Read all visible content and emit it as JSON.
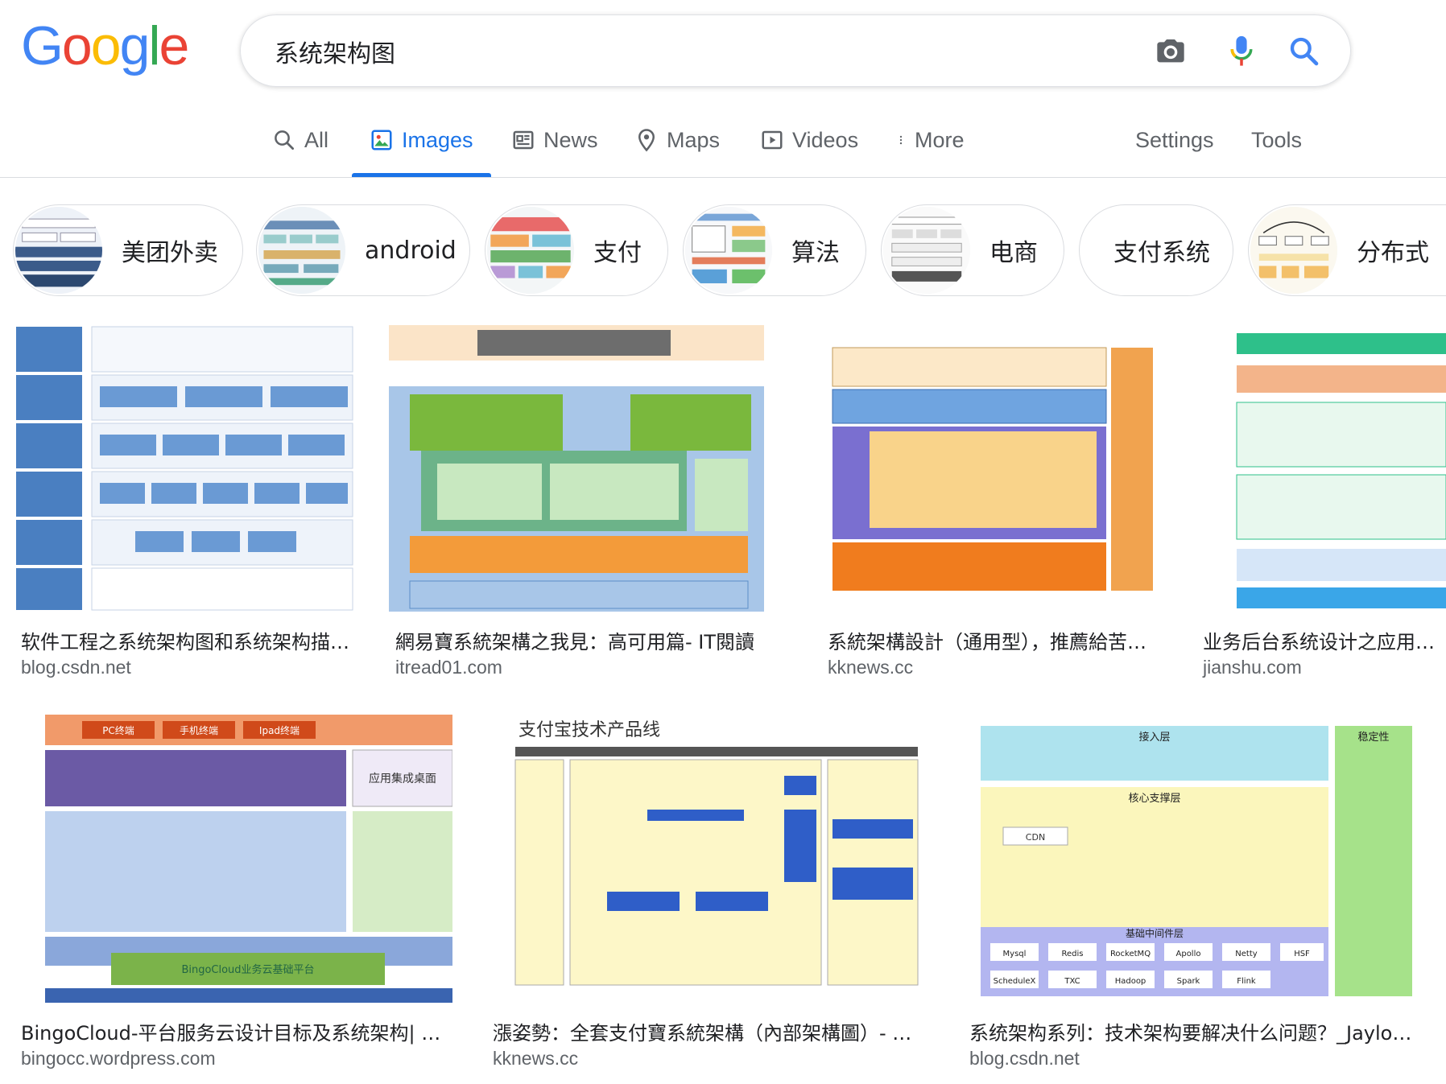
{
  "logo": {
    "letters": [
      "G",
      "o",
      "o",
      "g",
      "l",
      "e"
    ],
    "colors": [
      "#4285F4",
      "#EA4335",
      "#FBBC05",
      "#4285F4",
      "#34A853",
      "#EA4335"
    ]
  },
  "search": {
    "query": "系统架构图",
    "icons": [
      "camera-icon",
      "mic-icon",
      "search-icon"
    ]
  },
  "tabs": [
    {
      "label": "All",
      "icon": "search-icon"
    },
    {
      "label": "Images",
      "icon": "image-icon",
      "active": true
    },
    {
      "label": "News",
      "icon": "news-icon"
    },
    {
      "label": "Maps",
      "icon": "map-pin-icon"
    },
    {
      "label": "Videos",
      "icon": "video-icon"
    },
    {
      "label": "More",
      "icon": "more-vert-icon"
    },
    {
      "label": "Settings"
    },
    {
      "label": "Tools"
    }
  ],
  "chips": [
    {
      "label": "美团外卖"
    },
    {
      "label": "android"
    },
    {
      "label": "支付"
    },
    {
      "label": "算法"
    },
    {
      "label": "电商"
    },
    {
      "label": "支付系统"
    },
    {
      "label": "分布式"
    }
  ],
  "results": [
    {
      "title": "软件工程之系统架构图和系统架构描述方法",
      "site": "blog.csdn.net"
    },
    {
      "title": "網易寶系統架構之我見：高可用篇- IT閱讀",
      "site": "itread01.com"
    },
    {
      "title": "系統架構設計（通用型），推薦給苦惱的你",
      "site": "kknews.cc"
    },
    {
      "title": "业务后台系统设计之应用架构",
      "site": "jianshu.com"
    },
    {
      "title": "BingoCloud-平台服务云设计目标及系统架构| 品高",
      "site": "bingocc.wordpress.com",
      "image_text": [
        "PC终端",
        "手机终端",
        "Ipad终端",
        "应用集成桌面",
        "BingoCloud业务云基础平台"
      ]
    },
    {
      "title": "漲姿勢：全套支付寶系統架構（內部架構圖）- 每日頭條",
      "site": "kknews.cc",
      "image_text": [
        "支付宝技术产品线"
      ]
    },
    {
      "title": "系统架构系列：技术架构要解决什么问题？_Jaylon的博客",
      "site": "blog.csdn.net",
      "image_text": [
        "接入层",
        "核心支撑层",
        "基础中间件层",
        "稳定性",
        "CDN",
        "Mysql",
        "Redis",
        "RocketMQ",
        "Apollo",
        "Netty",
        "HSF",
        "ScheduleX",
        "TXC",
        "Hadoop",
        "Spark",
        "Flink"
      ]
    }
  ],
  "colors": {
    "accent": "#1a73e8",
    "text": "#202124",
    "muted": "#5f6368",
    "border": "#dadce0"
  }
}
